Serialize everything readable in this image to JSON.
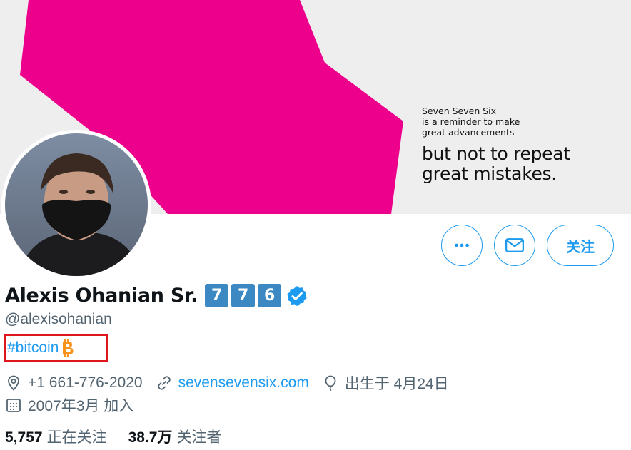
{
  "banner": {
    "line1": "Seven Seven Six",
    "line2": "is a reminder to make",
    "line3": "great advancements",
    "line4": "but not to repeat",
    "line5": "great mistakes.",
    "accent_color": "#ec008c"
  },
  "actions": {
    "more_icon": "more-horizontal-icon",
    "message_icon": "envelope-icon",
    "follow_label": "关注"
  },
  "profile": {
    "name": "Alexis Ohanian Sr.",
    "keycaps": [
      "7",
      "7",
      "6"
    ],
    "verified_icon": "verified-badge-icon",
    "handle": "@alexisohanian",
    "bio_hashtag": "#bitcoin",
    "bio_emoji_icon": "bitcoin-icon",
    "phone": "+1 661-776-2020",
    "website": "sevensevensix.com",
    "birthday": "出生于 4月24日",
    "joined": "2007年3月 加入"
  },
  "stats": {
    "following_count": "5,757",
    "following_label": "正在关注",
    "followers_count": "38.7万",
    "followers_label": "关注者"
  },
  "colors": {
    "link_blue": "#1d9bf0",
    "muted_gray": "#536471",
    "highlight_red": "#e0161d",
    "keycap_blue": "#3b88c3",
    "bitcoin_orange": "#f7931a"
  }
}
